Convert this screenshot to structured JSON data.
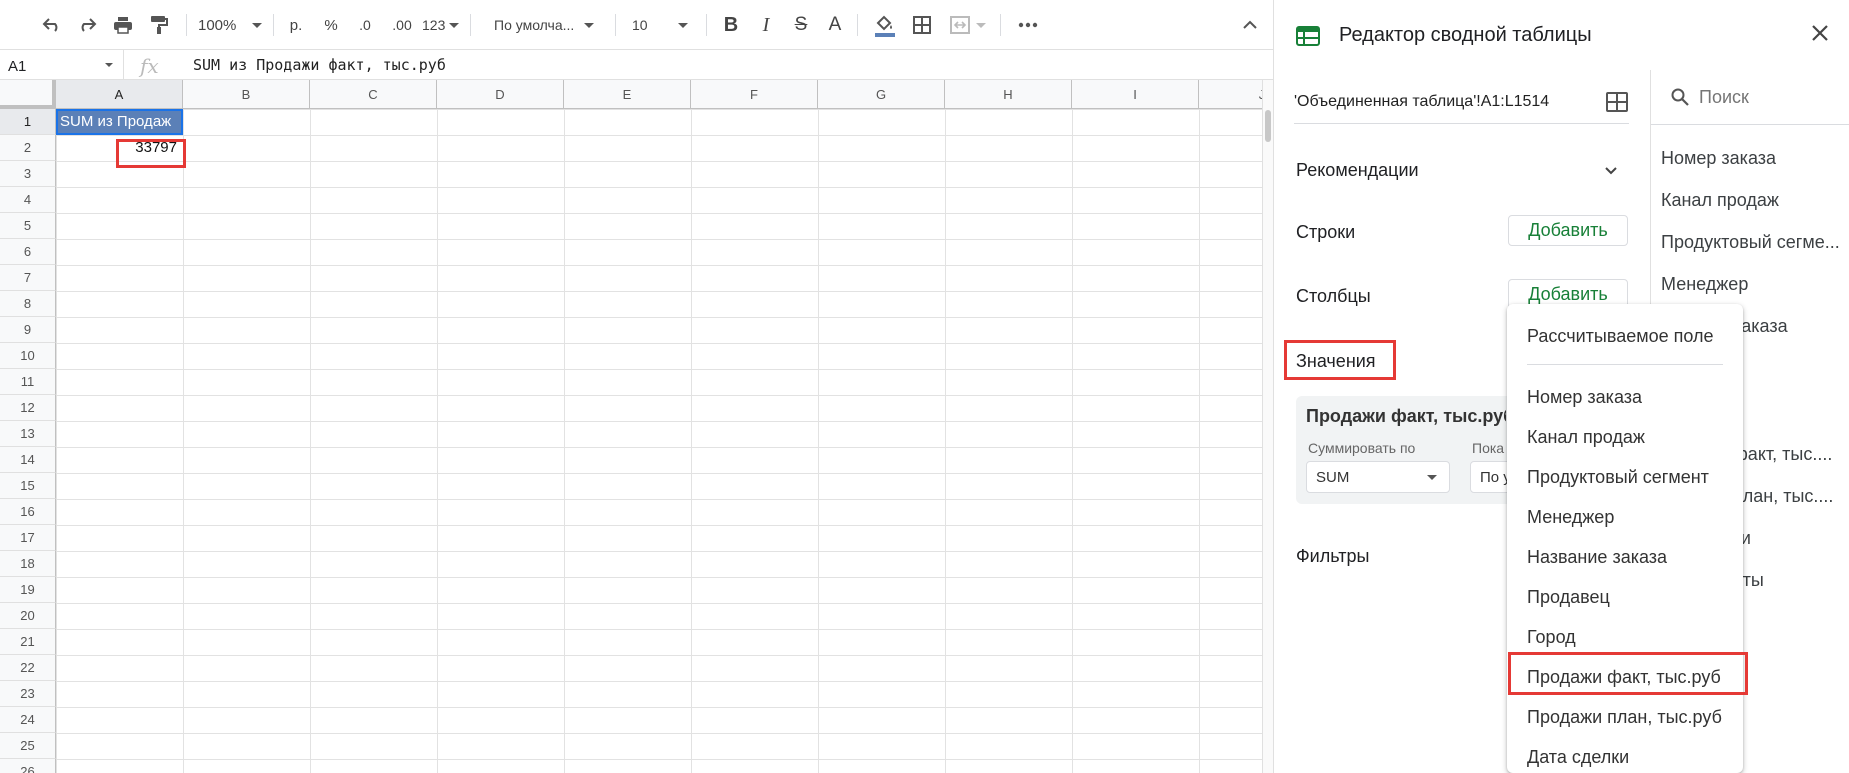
{
  "toolbar": {
    "zoom": "100%",
    "currency": "р.",
    "percent": "%",
    "dec_decrease": ".0",
    "dec_increase": ".00",
    "more_formats": "123",
    "font": "По умолча...",
    "font_size": "10",
    "bold": "B",
    "italic": "I",
    "strike": "S",
    "text_color": "A"
  },
  "formula_bar": {
    "cell_ref": "A1",
    "fx": "fx",
    "formula": "SUM из Продажи факт, тыс.руб"
  },
  "grid": {
    "columns": [
      "A",
      "B",
      "C",
      "D",
      "E",
      "F",
      "G",
      "H",
      "I",
      "J"
    ],
    "rows": [
      "1",
      "2",
      "3",
      "4",
      "5",
      "6",
      "7",
      "8",
      "9",
      "10",
      "11",
      "12",
      "13",
      "14",
      "15",
      "16",
      "17",
      "18",
      "19",
      "20",
      "21",
      "22",
      "23",
      "24",
      "25",
      "26"
    ],
    "a1": "SUM из Продаж",
    "a2": "33797"
  },
  "panel": {
    "title": "Редактор сводной таблицы",
    "range": "'Объединенная таблица'!A1:L1514",
    "recommendations": "Рекомендации",
    "rows": "Строки",
    "columns": "Столбцы",
    "values": "Значения",
    "filters": "Фильтры",
    "add": "Добавить",
    "value_card": {
      "title": "Продажи факт, тыс.руб",
      "summarize_label": "Суммировать по",
      "summarize_value": "SUM",
      "show_label": "Пока",
      "show_value": "По у"
    }
  },
  "fields": {
    "search_placeholder": "Поиск",
    "items": [
      "Номер заказа",
      "Канал продаж",
      "Продуктовый сегме...",
      "Менеджер",
      "заказа",
      "факт, тыс....",
      "план, тыс....",
      "ки",
      "аты"
    ]
  },
  "menu": {
    "calculated": "Рассчитываемое поле",
    "items": [
      "Номер заказа",
      "Канал продаж",
      "Продуктовый сегмент",
      "Менеджер",
      "Название заказа",
      "Продавец",
      "Город",
      "Продажи факт, тыс.руб",
      "Продажи план, тыс.руб",
      "Дата сделки"
    ]
  },
  "colors": {
    "accent_green": "#188038",
    "header_fill": "#5b80b7",
    "highlight_red": "#e53935"
  }
}
